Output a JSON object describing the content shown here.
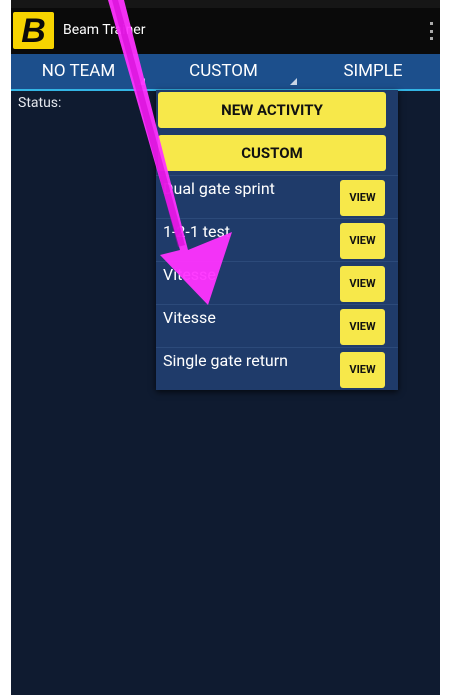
{
  "app": {
    "title": "Beam Trainer",
    "logo_letter": "B"
  },
  "tabs": [
    {
      "label": "NO TEAM"
    },
    {
      "label": "CUSTOM"
    },
    {
      "label": "SIMPLE"
    }
  ],
  "status": {
    "label": "Status:"
  },
  "menu": {
    "new_activity_label": "NEW ACTIVITY",
    "custom_label": "CUSTOM",
    "items": [
      {
        "label": "Dual gate sprint",
        "button": "VIEW"
      },
      {
        "label": "1-2-1 test",
        "button": "VIEW"
      },
      {
        "label": "Vitesse",
        "button": "VIEW"
      },
      {
        "label": "Vitesse",
        "button": "VIEW"
      },
      {
        "label": "Single gate return",
        "button": "VIEW"
      }
    ]
  },
  "colors": {
    "background": "#0f1b30",
    "tab_bar": "#1c4f8c",
    "menu": "#1f3b6a",
    "button_yellow": "#f7e84a",
    "annotation_arrow": "#ff33ff"
  },
  "icons": {
    "overflow": "overflow-menu-icon",
    "logo": "beam-logo-icon",
    "annotation": "pointer-arrow-icon"
  }
}
